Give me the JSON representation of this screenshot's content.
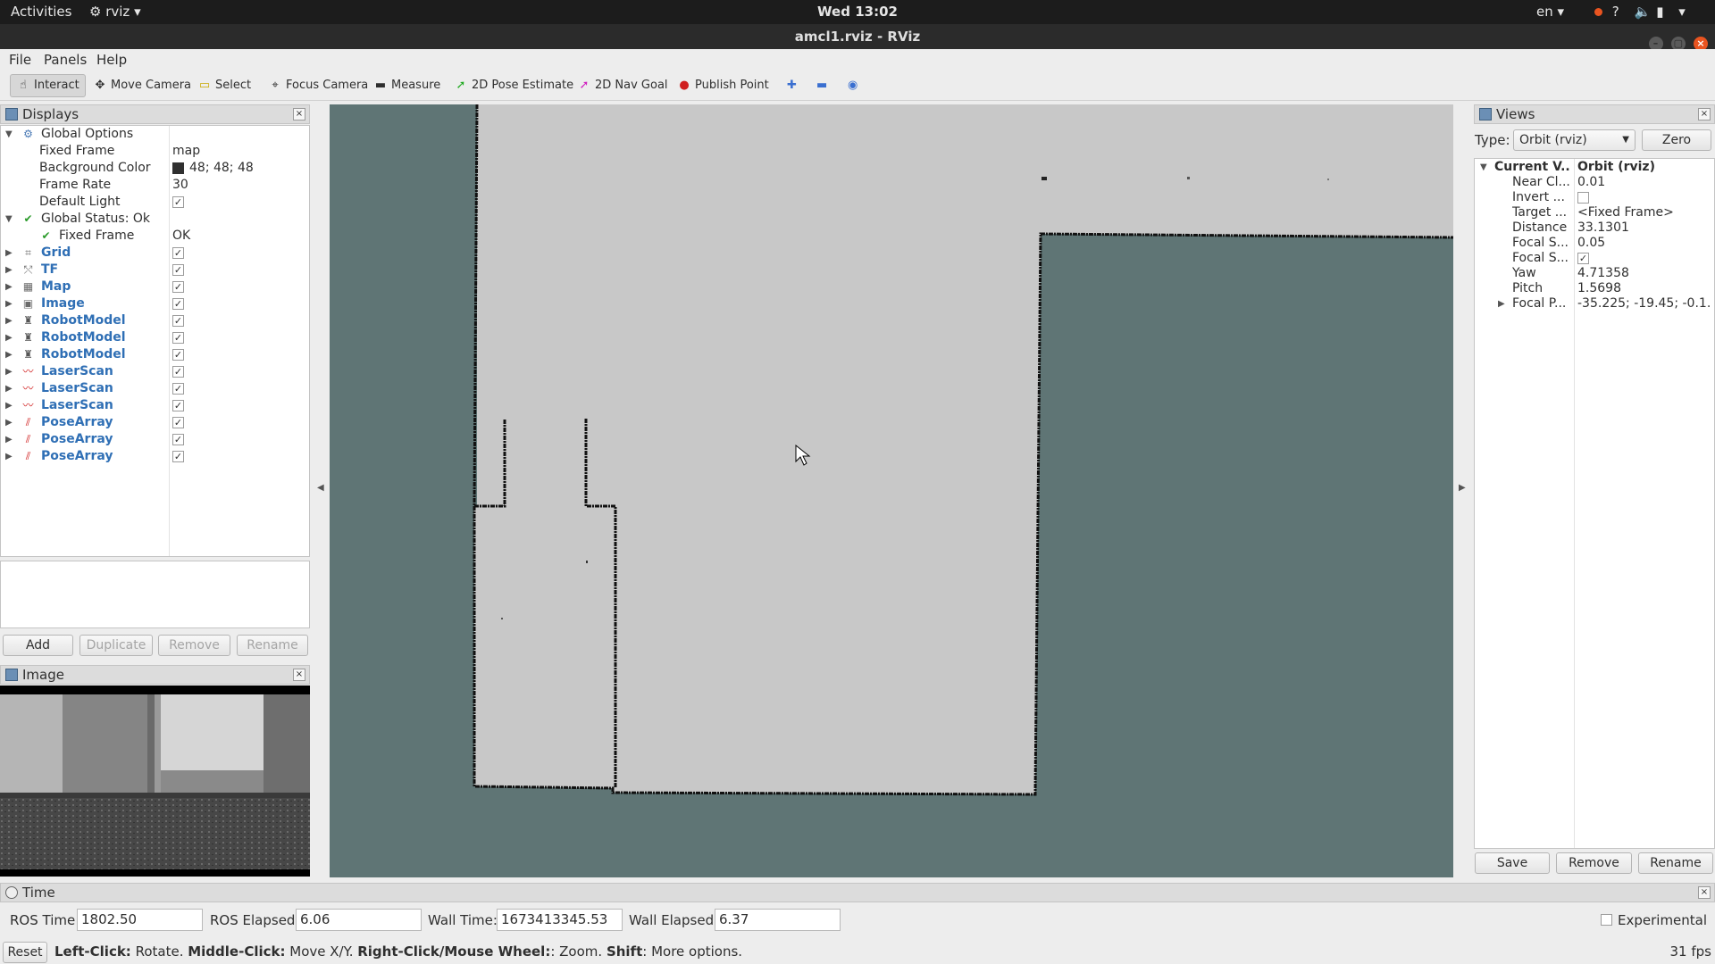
{
  "topbar": {
    "activities": "Activities",
    "app_menu": "rviz",
    "clock": "Wed 13:02",
    "language": "en",
    "tray": "?"
  },
  "window": {
    "title": "amcl1.rviz - RViz"
  },
  "menubar": {
    "items": [
      "File",
      "Panels",
      "Help"
    ]
  },
  "toolbar": {
    "tools": [
      {
        "label": "Interact",
        "icon": "hand-icon"
      },
      {
        "label": "Move Camera",
        "icon": "move-camera-icon"
      },
      {
        "label": "Select",
        "icon": "select-icon"
      },
      {
        "label": "Focus Camera",
        "icon": "focus-camera-icon"
      },
      {
        "label": "Measure",
        "icon": "ruler-icon"
      },
      {
        "label": "2D Pose Estimate",
        "icon": "green-arrow-icon"
      },
      {
        "label": "2D Nav Goal",
        "icon": "pink-arrow-icon"
      },
      {
        "label": "Publish Point",
        "icon": "map-pin-icon"
      }
    ]
  },
  "displays": {
    "title": "Displays",
    "global_options": "Global Options",
    "fixed_frame_label": "Fixed Frame",
    "fixed_frame_value": "map",
    "bg_color_label": "Background Color",
    "bg_color_value": "48; 48; 48",
    "bg_color_hex": "#303030",
    "frame_rate_label": "Frame Rate",
    "frame_rate_value": "30",
    "default_light_label": "Default Light",
    "global_status": "Global Status: Ok",
    "status_fixed_frame_label": "Fixed Frame",
    "status_fixed_frame_value": "OK",
    "items": [
      {
        "label": "Grid",
        "icon": "grid-icon"
      },
      {
        "label": "TF",
        "icon": "tf-icon"
      },
      {
        "label": "Map",
        "icon": "map-icon"
      },
      {
        "label": "Image",
        "icon": "image-icon"
      },
      {
        "label": "RobotModel",
        "icon": "robot-icon"
      },
      {
        "label": "RobotModel",
        "icon": "robot-icon"
      },
      {
        "label": "RobotModel",
        "icon": "robot-icon"
      },
      {
        "label": "LaserScan",
        "icon": "laser-icon"
      },
      {
        "label": "LaserScan",
        "icon": "laser-icon"
      },
      {
        "label": "LaserScan",
        "icon": "laser-icon"
      },
      {
        "label": "PoseArray",
        "icon": "pose-array-icon"
      },
      {
        "label": "PoseArray",
        "icon": "pose-array-icon"
      },
      {
        "label": "PoseArray",
        "icon": "pose-array-icon"
      }
    ],
    "buttons": {
      "add": "Add",
      "duplicate": "Duplicate",
      "remove": "Remove",
      "rename": "Rename"
    }
  },
  "image_panel": {
    "title": "Image"
  },
  "views": {
    "title": "Views",
    "type_label": "Type:",
    "type_value": "Orbit (rviz)",
    "zero": "Zero",
    "current_view_label": "Current V...",
    "current_view_value": "Orbit (rviz)",
    "rows": [
      {
        "label": "Near Cl...",
        "value": "0.01"
      },
      {
        "label": "Invert ...",
        "value": ""
      },
      {
        "label": "Target ...",
        "value": "<Fixed Frame>"
      },
      {
        "label": "Distance",
        "value": "33.1301"
      },
      {
        "label": "Focal S...",
        "value": "0.05"
      },
      {
        "label": "Focal S...",
        "value": ""
      },
      {
        "label": "Yaw",
        "value": "4.71358"
      },
      {
        "label": "Pitch",
        "value": "1.5698"
      },
      {
        "label": "Focal P...",
        "value": "-35.225; -19.45; -0.1..."
      }
    ],
    "buttons": {
      "save": "Save",
      "remove": "Remove",
      "rename": "Rename"
    }
  },
  "time": {
    "title": "Time",
    "ros_time_label": "ROS Time:",
    "ros_time": "1802.50",
    "ros_elapsed_label": "ROS Elapsed:",
    "ros_elapsed": "6.06",
    "wall_time_label": "Wall Time:",
    "wall_time": "1673413345.53",
    "wall_elapsed_label": "Wall Elapsed:",
    "wall_elapsed": "6.37",
    "experimental": "Experimental"
  },
  "status": {
    "reset": "Reset",
    "h1": "Left-Click:",
    "t1": " Rotate. ",
    "h2": "Middle-Click:",
    "t2": " Move X/Y. ",
    "h3": "Right-Click/Mouse Wheel:",
    "t3": ": Zoom. ",
    "h4": "Shift",
    "t4": ": More options.",
    "fps": "31 fps"
  },
  "colors": {
    "viewport_bg": "#5f7575",
    "map_free": "#c8c8c8",
    "link_blue": "#2f6fb5",
    "accent": "#e95420"
  }
}
